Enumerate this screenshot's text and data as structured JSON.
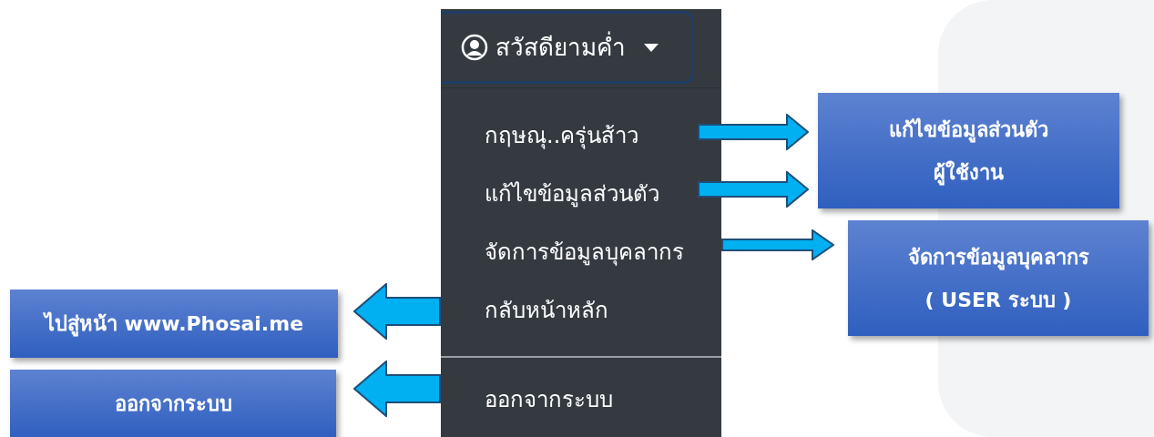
{
  "user_menu": {
    "toggle": {
      "label": "สวัสดียามค่ำ"
    },
    "items": [
      {
        "kind": "item",
        "label": "กฤษณุ..ครุ่นส้าว"
      },
      {
        "kind": "item",
        "label": "แก้ไขข้อมูลส่วนตัว"
      },
      {
        "kind": "item",
        "label": "จัดการข้อมูลบุคลากร"
      },
      {
        "kind": "item",
        "label": "กลับหน้าหลัก"
      },
      {
        "kind": "divider"
      },
      {
        "kind": "item",
        "label": "ออกจากระบบ"
      }
    ]
  },
  "annotations": [
    {
      "kind": "right",
      "lines": [
        "แก้ไขข้อมูลส่วนตัว",
        "ผู้ใช้งาน"
      ]
    },
    {
      "kind": "right",
      "lines": [
        "จัดการข้อมูลบุคลากร",
        "( USER ระบบ )"
      ]
    },
    {
      "kind": "left",
      "lines": [
        "ไปสู่หน้า www.Phosai.me"
      ]
    },
    {
      "kind": "left",
      "lines": [
        "ออกจากระบบ"
      ]
    }
  ]
}
